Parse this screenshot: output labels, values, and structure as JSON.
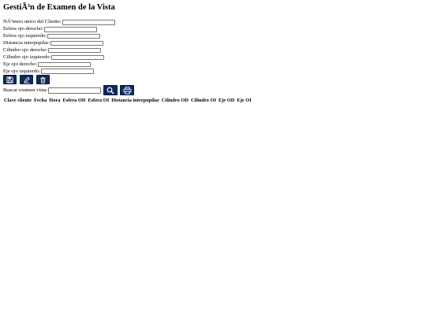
{
  "title": "GestiÃ³n de Examen de la Vista",
  "fields": [
    {
      "label": "NÃºmero unico del Cliente:",
      "value": ""
    },
    {
      "label": "Esfera ojo derecho:",
      "value": ""
    },
    {
      "label": "Esfera ojo izquierdo:",
      "value": ""
    },
    {
      "label": "Distancia interpupilar:",
      "value": ""
    },
    {
      "label": "Cilindro ojo derecho:",
      "value": ""
    },
    {
      "label": "Cilindro ojo izquierdo:",
      "value": ""
    },
    {
      "label": "Eje ojo derecho:",
      "value": ""
    },
    {
      "label": "Eje ojo izquierdo:",
      "value": ""
    }
  ],
  "actions": [
    {
      "icon": "save-icon"
    },
    {
      "icon": "edit-icon"
    },
    {
      "icon": "trash-icon"
    }
  ],
  "search": {
    "label": "Buscar examen vista:",
    "value": "",
    "search_icon": "search-icon",
    "print_icon": "print-icon"
  },
  "table": {
    "columns": [
      "Clave cliente",
      "Fecha",
      "Hora",
      "Esfera OD",
      "Esfera OI",
      "Distancia interpupilar",
      "Cilindro OD",
      "Cilindro OI",
      "Eje OD",
      "Eje OI"
    ],
    "rows": []
  },
  "colors": {
    "button_bg": "#0e2a5c",
    "icon": "#ffffff"
  }
}
